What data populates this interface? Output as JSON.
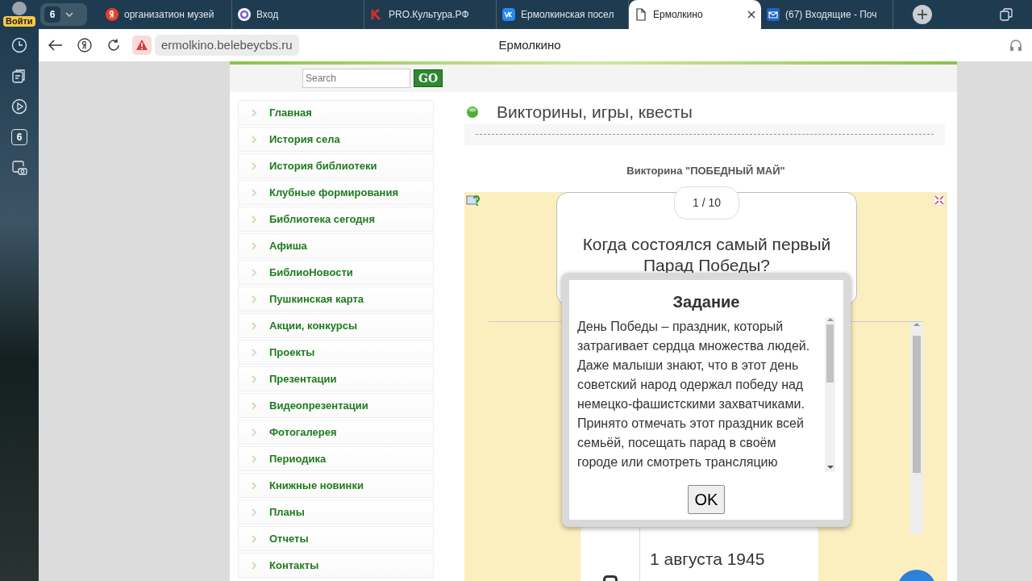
{
  "browser": {
    "profile_badge": "Войти",
    "tab_group_count": "6",
    "tabs": [
      {
        "title": "организатион музей",
        "kind": "ya",
        "selected": false
      },
      {
        "title": "Вход",
        "kind": "ring",
        "selected": false
      },
      {
        "title": "PRO.Культура.РФ",
        "kind": "k",
        "selected": false
      },
      {
        "title": "Ермолкинская посел",
        "kind": "vk",
        "selected": false
      },
      {
        "title": "Ермолкино",
        "kind": "page",
        "selected": true
      },
      {
        "title": "(67) Входящие - Поч",
        "kind": "mail",
        "selected": false
      }
    ],
    "address": "ermolkino.belebeycbs.ru",
    "page_title": "Ермолкино",
    "sidebar_counter": "6"
  },
  "site": {
    "search": {
      "placeholder": "Search"
    },
    "go_button": "GO",
    "menu": [
      "Главная",
      "История села",
      "История библиотеки",
      "Клубные формирования",
      "Библиотека сегодня",
      "Афиша",
      "БиблиоНовости",
      "Пушкинская карта",
      "Акции, конкурсы",
      "Проекты",
      "Презентации",
      "Видеопрезентации",
      "Фотогалерея",
      "Периодика",
      "Книжные новинки",
      "Планы",
      "Отчеты",
      "Контакты"
    ],
    "section_title": "Викторины, игры, квесты",
    "quiz_title": "Викторина \"ПОБЕДНЫЙ МАЙ\"",
    "quiz": {
      "counter": "1 / 10",
      "question": "Когда состоялся самый первый Парад Победы?",
      "dialog": {
        "title": "Задание",
        "text": "День Победы – праздник, который затрагивает сердца множества людей. Даже малыши знают, что в этот день советский народ одержал победу над немецко-фашистскими захватчиками. Принято отмечать этот праздник всей семьёй, посещать парад в своём городе или смотреть трансляцию",
        "ok_button": "OK"
      },
      "answer": "1 августа 1945"
    }
  }
}
